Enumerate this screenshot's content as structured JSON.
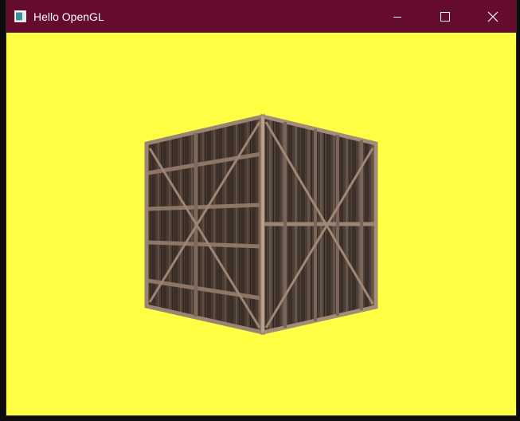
{
  "window": {
    "title": "Hello OpenGL",
    "icon": "opengl-app-icon",
    "titlebar_color": "#650b2e",
    "clear_color": "#ffff44",
    "controls": {
      "minimize_icon": "minimize-icon",
      "maximize_icon": "maximize-icon",
      "close_icon": "close-icon"
    }
  },
  "scene": {
    "object": "textured-cube",
    "texture": "wooden-crate",
    "wood_colors": {
      "plank_dark": "#3b2f28",
      "plank_mid": "#5a4a40",
      "frame": "#8a7565",
      "frame_light": "#b39a85"
    }
  }
}
